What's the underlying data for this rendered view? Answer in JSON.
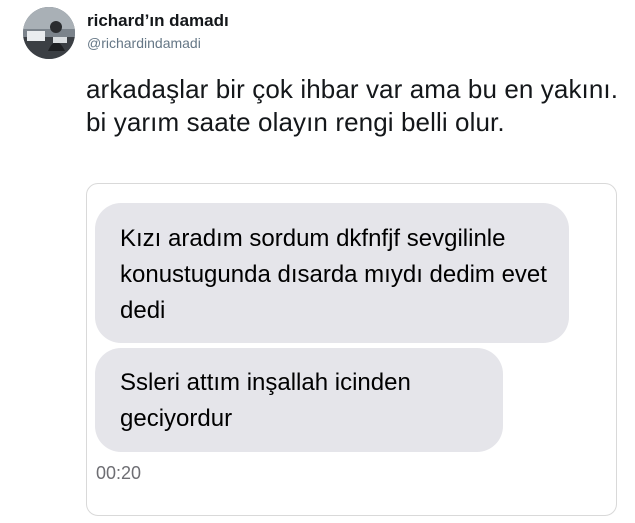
{
  "tweet": {
    "display_name": "richard’ın damadı",
    "handle": "@richardindamadi",
    "text": "arkadaşlar bir çok ihbar var ama bu en yakını. bi yarım saate olayın rengi belli olur."
  },
  "screenshot": {
    "messages": [
      {
        "text": "Kızı aradım sordum dkfnfjf sevgilinle konustugunda dısarda mıydı dedim evet dedi"
      },
      {
        "text": "Ssleri attım inşallah icinden geciyordur"
      }
    ],
    "time": "00:20"
  },
  "colors": {
    "bubble_gray": "#e5e5ea",
    "handle_gray": "#657786",
    "text_dark": "#14171a"
  }
}
